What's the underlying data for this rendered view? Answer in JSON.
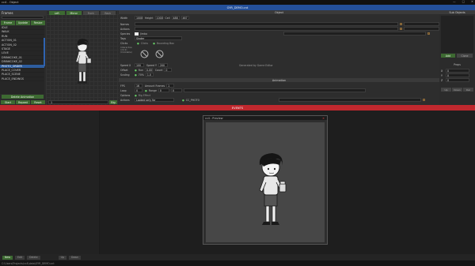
{
  "window": {
    "title": "cc4 - Object",
    "controls": [
      "—",
      "□",
      "✕"
    ]
  },
  "header": {
    "file_title": "GYR_DEMO.cnt"
  },
  "left_panel": {
    "title": "Frames",
    "tabs": [
      "Frame",
      "Update",
      "Resize"
    ],
    "items": [
      "IDLE",
      "WALK",
      "RUN",
      "ACTION_01",
      "ACTION_02",
      "STAGE",
      "LOVE",
      "DRINKCOKE_01",
      "DRINKCOKE_02",
      "PHOTO_ORDER",
      "PLACE_COVER",
      "PLACE_SCENE",
      "PLACE_ENDINGS"
    ],
    "selected_index": 9,
    "delete_label": "Delete Animation",
    "play_buttons": [
      "Start",
      "Repeat",
      "Reset"
    ],
    "frame_value": "1",
    "big_label": "Big"
  },
  "grid_buttons": [
    "Left",
    "Mirror",
    "Front",
    "Back"
  ],
  "object_panel": {
    "title": "Object",
    "rows": {
      "width_label": "Width",
      "width_value": "1000",
      "height_label": "Height",
      "height_value": "1000",
      "cell_label": "Cell",
      "cell_x": "488",
      "cell_y": "467",
      "names_label": "Names",
      "actions_label": "Actions",
      "species_label": "Species",
      "species_value": "Jimbo",
      "tags_label": "Tags",
      "tags_value": "Skater",
      "clicks_label": "Clicks",
      "bounding_box_label": "Bounding Box",
      "interaction_label": "Interaction (click) (Clickable)",
      "speed_label": "Speed X",
      "speed_value": "100",
      "speed_y_label": "Speed Y",
      "speed_y_value": "200",
      "generated_label": "Generated by Game Editor",
      "offset_label": "Offset",
      "run_label": "Run",
      "run_value": "0.00",
      "count_label": "Count",
      "count_value": "0",
      "scaling_label": "Scaling",
      "scaling_pct": "70%",
      "scaling_value": "1.0"
    },
    "animation_title": "Animation",
    "anim": {
      "fps_label": "FPS",
      "fps_value": "16",
      "amount_label": "Amount Frames",
      "amount_value": "1",
      "loop_label": "Loop",
      "loop_value": "0",
      "range_label": "Range",
      "range_a": "0",
      "range_b": "0",
      "options_label": "Options",
      "options_value": "Big Effect",
      "actions_label": "Actions",
      "actions_value": "Looked only for",
      "ptr_value": "CC_PHOTO"
    }
  },
  "right_panel": {
    "title": "Sub Objects",
    "add_label": "Add",
    "clone_label": "Clone",
    "props_title": "Props",
    "props": [
      [
        "X",
        "0"
      ],
      [
        "Y",
        "0"
      ],
      [
        "Z",
        "0"
      ]
    ],
    "buttons": [
      "Up",
      "Down",
      "Del"
    ]
  },
  "events": {
    "title": "EVENTS"
  },
  "preview": {
    "title": "cc4 - Preview",
    "close": "✕"
  },
  "bottom_bar": [
    "New",
    "Edit",
    "Delete",
    "Up",
    "Down"
  ],
  "status_text": "C:\\Users\\Projects\\cc4\\data\\GYR_DEMO.cnt",
  "colors": {
    "accent_blue": "#24509a",
    "events_red": "#c0282e",
    "button_green": "#3d6a32",
    "selection": "#2e5d9e"
  }
}
